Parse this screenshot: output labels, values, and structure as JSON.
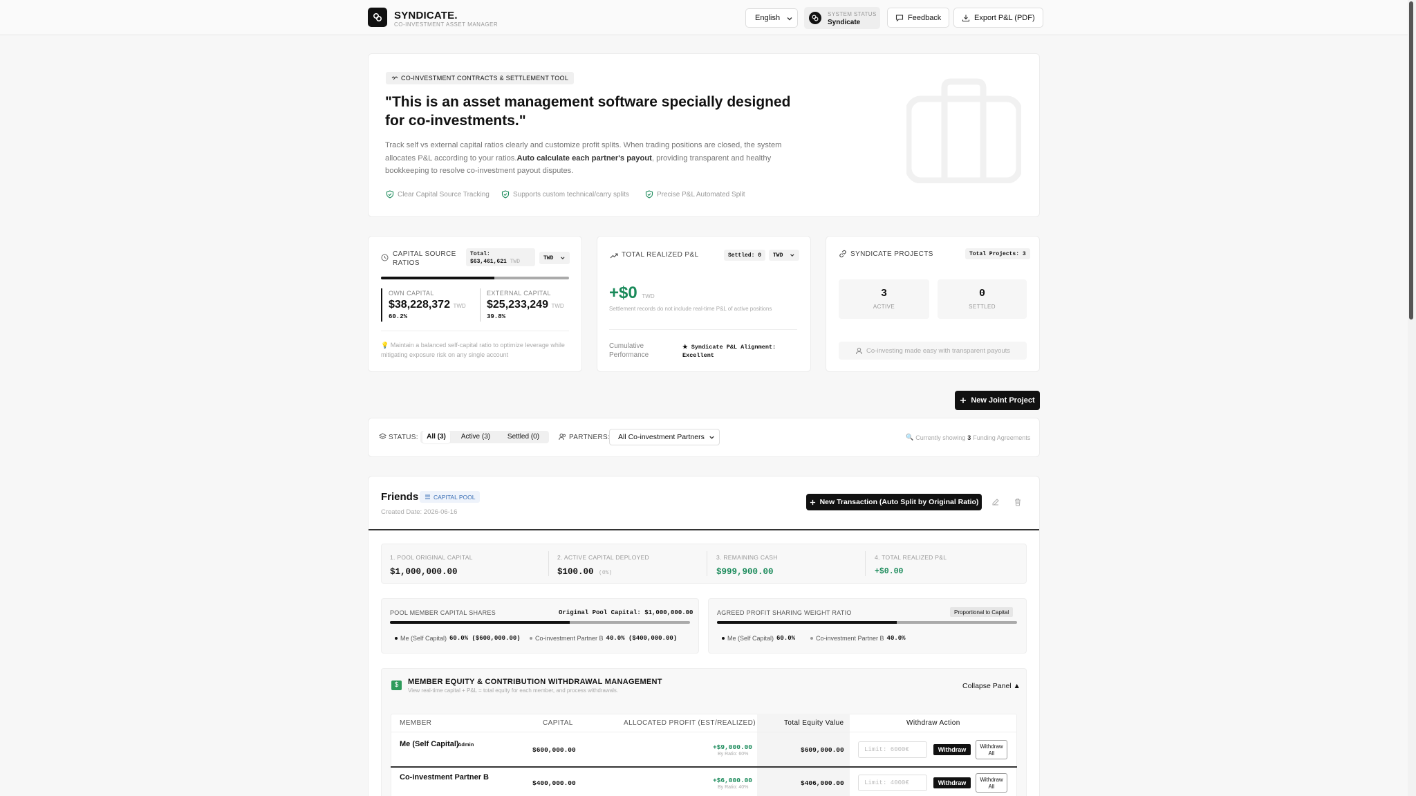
{
  "header": {
    "brand": "SYNDICATE.",
    "brand_sub": "CO-INVESTMENT ASSET MANAGER",
    "language": "English",
    "status_label": "SYSTEM STATUS",
    "status_value": "Syndicate",
    "feedback_label": "Feedback",
    "export_label": "Export P&L (PDF)"
  },
  "hero": {
    "tag": "CO-INVESTMENT CONTRACTS & SETTLEMENT TOOL",
    "title": "\"This is an asset management software specially designed for co-investments.\"",
    "desc_1": "Track self vs external capital ratios clearly and customize profit splits. When trading positions are closed, the system allocates P&L according to your ratios.",
    "desc_bold": "Auto calculate each partner's payout",
    "desc_2": ", providing transparent and healthy bookkeeping to resolve co-investment payout disputes.",
    "features": [
      "Clear Capital Source Tracking",
      "Supports custom technical/carry splits",
      "Precise P&L Automated Split"
    ]
  },
  "capital_card": {
    "title_1": "CAPITAL SOURCE",
    "title_2": "RATIOS",
    "total_label": "Total:",
    "total_value": "$63,461,621",
    "total_unit": "TWD",
    "currency": "TWD",
    "ratio": 0.602,
    "own_label": "OWN CAPITAL",
    "own_value": "$38,228,372",
    "own_unit": "TWD",
    "own_pct": "60.2%",
    "ext_label": "EXTERNAL CAPITAL",
    "ext_value": "$25,233,249",
    "ext_unit": "TWD",
    "ext_pct": "39.8%",
    "tip": "Maintain a balanced self-capital ratio to optimize leverage while mitigating exposure risk on any single account"
  },
  "pnl_card": {
    "title": "TOTAL REALIZED P&L",
    "settled": "Settled: 0",
    "currency": "TWD",
    "value": "+$0",
    "unit": "TWD",
    "note": "Settlement records do not include real-time P&L of active positions",
    "perf_label_1": "Cumulative",
    "perf_label_2": "Performance",
    "alignment_1": "★ Syndicate P&L Alignment:",
    "alignment_2": "Excellent"
  },
  "projects_card": {
    "title": "SYNDICATE PROJECTS",
    "total": "Total Projects: 3",
    "active_count": "3",
    "active_label": "ACTIVE",
    "settled_count": "0",
    "settled_label": "SETTLED",
    "footer": "Co-investing made easy with transparent payouts"
  },
  "new_project_label": "New Joint Project",
  "filters": {
    "status_label": "STATUS:",
    "tabs": [
      "All (3)",
      "Active (3)",
      "Settled (0)"
    ],
    "partners_label": "PARTNERS:",
    "partners_value": "All Co-investment Partners",
    "showing_1": "Currently showing",
    "showing_count": "3",
    "showing_2": "Funding Agreements"
  },
  "project": {
    "name": "Friends",
    "badge": "CAPITAL POOL",
    "created": "Created Date: 2026-06-16",
    "new_txn_label": "New Transaction (Auto Split by Original Ratio)",
    "stats": [
      {
        "label": "1. POOL ORIGINAL CAPITAL",
        "value": "$1,000,000.00",
        "suffix": ""
      },
      {
        "label": "2. ACTIVE CAPITAL DEPLOYED",
        "value": "$100.00",
        "suffix": "(0%)"
      },
      {
        "label": "3. REMAINING CASH",
        "value": "$999,900.00",
        "suffix": ""
      },
      {
        "label": "4. TOTAL REALIZED P&L",
        "value": "+$0.00",
        "suffix": ""
      }
    ],
    "shares": {
      "title": "POOL MEMBER CAPITAL SHARES",
      "orig_label": "Original Pool Capital: $1,000,000.00",
      "ratio": 0.6,
      "me_label": "Me (Self Capital)",
      "me_val": "60.0% ($600,000.00)",
      "b_label": "Co-investment Partner B",
      "b_val": "40.0% ($400,000.00)"
    },
    "weights": {
      "title": "AGREED PROFIT SHARING WEIGHT RATIO",
      "badge": "Proportional to Capital",
      "ratio": 0.6,
      "me_label": "Me (Self Capital)",
      "me_val": "60.0%",
      "b_label": "Co-investment Partner B",
      "b_val": "40.0%"
    },
    "equity": {
      "title": "MEMBER EQUITY & CONTRIBUTION WITHDRAWAL MANAGEMENT",
      "sub": "View real-time capital + P&L = total equity for each member, and process withdrawals.",
      "collapse": "Collapse Panel ▲",
      "cols": [
        "MEMBER",
        "CAPITAL",
        "ALLOCATED PROFIT (EST/REALIZED)",
        "Total Equity Value",
        "Withdraw Action"
      ],
      "rows": [
        {
          "name": "Me (Self Capital)",
          "badge": "Admin",
          "capital": "$600,000.00",
          "profit": "+$9,000.00",
          "ratio": "By Ratio: 60%",
          "equity": "$609,000.00",
          "placeholder": "Limit: 6000€",
          "withdraw": "Withdraw",
          "withdraw_all_1": "Withdraw",
          "withdraw_all_2": "All"
        },
        {
          "name": "Co-investment Partner B",
          "badge": "",
          "capital": "$400,000.00",
          "profit": "+$6,000.00",
          "ratio": "By Ratio: 40%",
          "equity": "$406,000.00",
          "placeholder": "Limit: 4000€",
          "withdraw": "Withdraw",
          "withdraw_all_1": "Withdraw",
          "withdraw_all_2": "All"
        }
      ]
    }
  },
  "colors": {
    "accent_green": "#1a8a5a",
    "dark": "#111111"
  }
}
